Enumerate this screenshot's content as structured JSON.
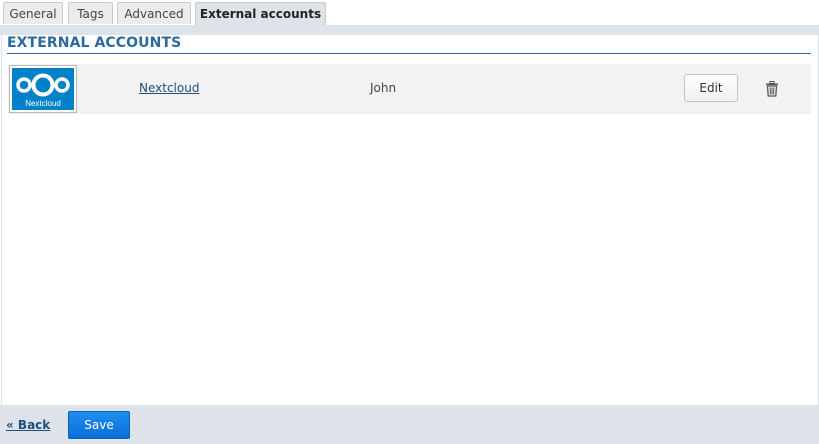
{
  "tabs": [
    {
      "label": "General",
      "active": false
    },
    {
      "label": "Tags",
      "active": false
    },
    {
      "label": "Advanced",
      "active": false
    },
    {
      "label": "External accounts",
      "active": true
    }
  ],
  "section": {
    "title": "EXTERNAL ACCOUNTS"
  },
  "accounts": [
    {
      "logo_text": "Nextcloud",
      "logo_icon": "nextcloud-logo-icon",
      "service": "Nextcloud",
      "username": "John",
      "edit_label": "Edit",
      "delete_icon": "trash-icon"
    }
  ],
  "footer": {
    "back_label": "« Back",
    "save_label": "Save"
  },
  "colors": {
    "accent": "#2c6a9e",
    "nextcloud_blue": "#0082c9",
    "save_button": "#1178de",
    "chrome_bg": "#dde3e9"
  }
}
